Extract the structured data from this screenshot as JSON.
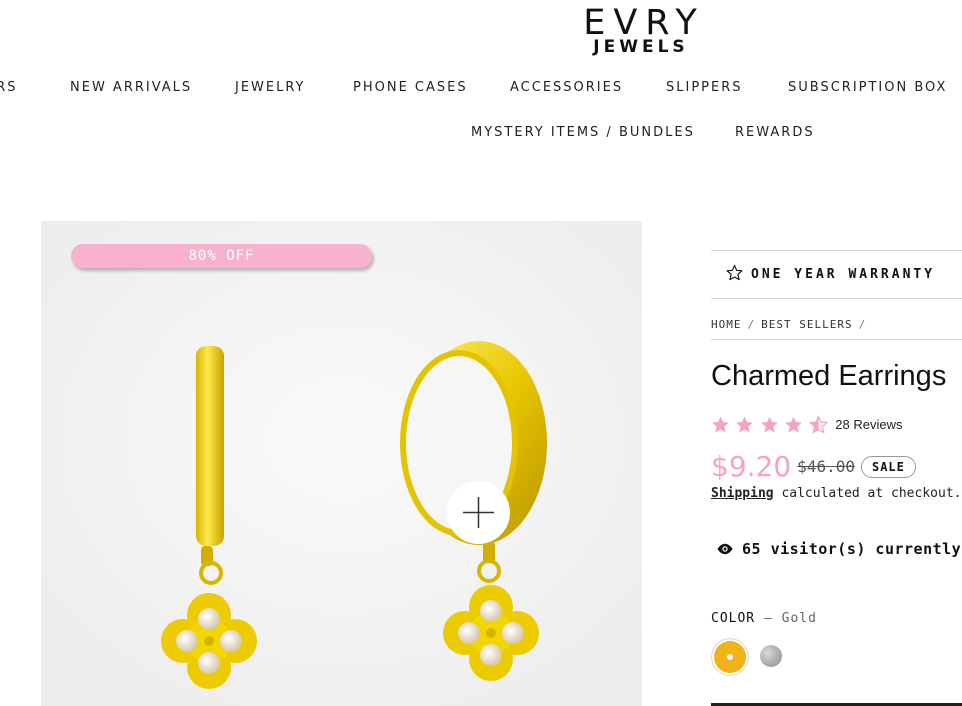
{
  "brand": {
    "name": "EVRY",
    "sub": "JEWELS"
  },
  "nav": {
    "row1": [
      "ERS",
      "NEW ARRIVALS",
      "JEWELRY",
      "PHONE CASES",
      "ACCESSORIES",
      "SLIPPERS",
      "SUBSCRIPTION BOX"
    ],
    "row2": [
      "MYSTERY ITEMS / BUNDLES",
      "REWARDS"
    ]
  },
  "gallery": {
    "badge": "80% OFF",
    "zoom_icon": "plus-icon"
  },
  "product": {
    "warranty": "ONE YEAR WARRANTY",
    "breadcrumb": [
      "HOME",
      "BEST SELLERS"
    ],
    "breadcrumb_sep": "/",
    "title": "Charmed Earrings",
    "rating": 4.5,
    "reviews": "28 Reviews",
    "price": "$9.20",
    "compare_price": "$46.00",
    "sale_badge": "SALE",
    "shipping_link": "Shipping",
    "shipping_text": "calculated at checkout.",
    "visitors": "65 visitor(s) currently",
    "color_label": "COLOR",
    "color_dash": "—",
    "color_value": "Gold",
    "swatches": [
      "Gold",
      "Silver"
    ]
  },
  "colors": {
    "accent_pink": "#f7a2c4",
    "badge_pink": "#f9b2cd",
    "gold": "#f2b21a"
  }
}
